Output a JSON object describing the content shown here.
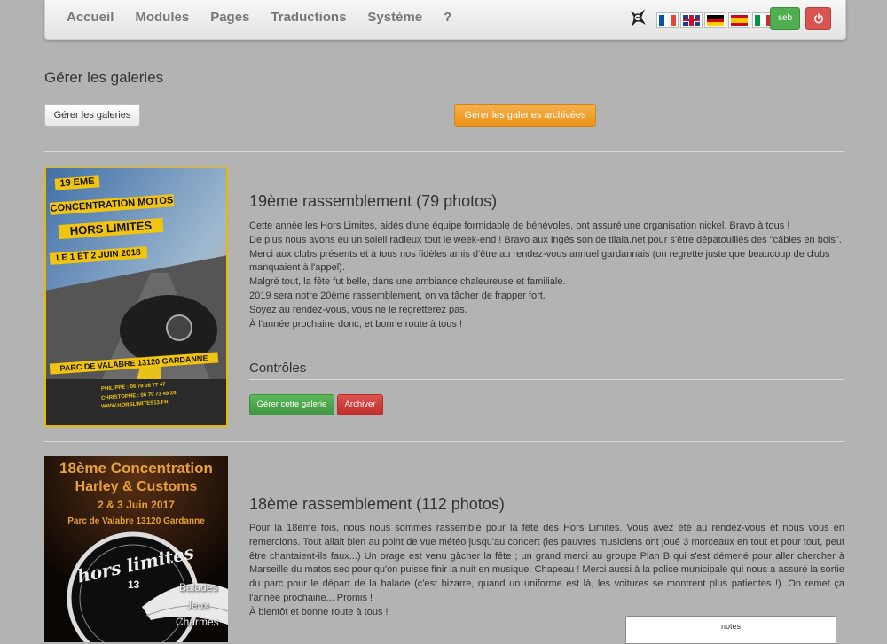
{
  "navbar": {
    "menu": [
      "Accueil",
      "Modules",
      "Pages",
      "Traductions",
      "Système",
      "?"
    ],
    "flags": [
      "fr",
      "en",
      "de",
      "es",
      "it"
    ],
    "user_label": "seb",
    "power_icon": "power-icon"
  },
  "page": {
    "title": "Gérer les galeries",
    "manage_button": "Gérer les galeries",
    "archived_button": "Gérer les galeries archivées"
  },
  "galleries": [
    {
      "title": "19ème rassemblement (79 photos)",
      "description": [
        "Cette année les Hors Limites, aidés d'une équipe formidable de bénévoles, ont assuré une organisation nickel. Bravo à tous !",
        "De plus nous avons eu un soleil radieux tout le week-end ! Bravo aux ingés son de tilala.net pour s'être dépatouillés des \"câbles en bois\".",
        "Merci aux clubs présents et à tous nos fidèles amis d'être au rendez-vous annuel gardannais (on regrette juste que beaucoup de clubs manquaient à l'appel).",
        "Malgré tout, la fête fut belle, dans une ambiance chaleureuse et familiale.",
        "2019 sera notre 20ème rassemblement, on va tâcher de frapper fort.",
        "Soyez au rendez-vous, vous ne le regretterez pas.",
        "À l'année prochaine donc, et bonne route à tous !"
      ],
      "controls_heading": "Contrôles",
      "manage_button": "Gérer cette galerie",
      "archive_button": "Archiver",
      "poster": {
        "line1": "19 EME",
        "line2": "CONCENTRATION MOTOS",
        "line3": "HORS LIMITES",
        "line4": "LE 1 ET 2 JUIN 2018",
        "line5": "PARC DE VALABRE 13120 GARDANNE",
        "line6": "PHILIPPE : 06 78 08 77 47",
        "line7": "CHRISTOPHE : 06 70 73 49 26",
        "line8": "WWW.HORSLIMITES13.FR"
      }
    },
    {
      "title": "18ème rassemblement (112 photos)",
      "description": [
        "Pour la 18ème fois, nous nous sommes rassemblé pour la fête des Hors Limites. Vous avez été au rendez-vous et nous vous en remercions. Tout allait bien au point de vue météo jusqu'au concert (les pauvres musiciens ont joué 3 morceaux en tout et pour tout, peut être chantaient-ils faux...) Un orage est venu gâcher la fête ; un grand merci au groupe Plan B qui s'est démené pour aller chercher à Marseille du matos sec pour qu'on puisse finir la nuit en musique. Chapeau ! Merci aussi à la police municipale qui nous a assuré la sortie du parc pour le départ de la balade (c'est bizarre, quand un uniforme est là, les voitures se montrent plus patientes !). On remet ça l'année prochaine... Promis !",
        "À bientôt et bonne route à tous !"
      ],
      "poster": {
        "line1": "18ème Concentration",
        "line2": "Harley & Customs",
        "line3": "2 & 3 Juin 2017",
        "line4": "Parc de Valabre 13120 Gardanne",
        "line5": "hors limites",
        "line6": "13",
        "line7": "Balades",
        "line8": "Jeux",
        "line9": "Charmes"
      }
    }
  ],
  "notes_label": "notes"
}
